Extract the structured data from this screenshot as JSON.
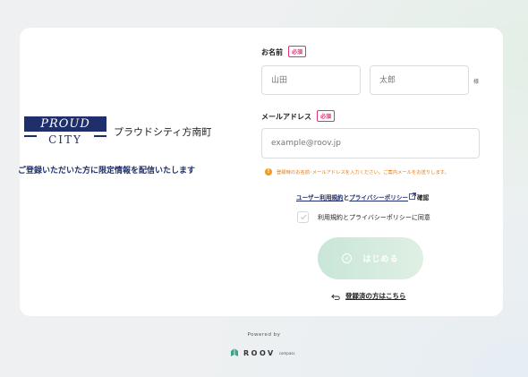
{
  "logo": {
    "mark_top": "PROUD",
    "mark_bottom": "CITY",
    "name": "プラウドシティ方南町"
  },
  "tagline": "ご登録いただいた方に限定情報を配信いたします",
  "form": {
    "name_label": "お名前",
    "required_badge": "必須",
    "last_name_placeholder": "山田",
    "first_name_placeholder": "太郎",
    "honorific": "様",
    "email_label": "メールアドレス",
    "email_placeholder": "example@roov.jp",
    "notice_icon": "!",
    "notice": "登録時のお名前･メールアドレスを入力ください。ご案内メールをお送りします。",
    "terms_link": "ユーザー利用規約",
    "terms_and": "と",
    "privacy_link": "プライバシーポリシー",
    "terms_confirm": "確認",
    "agree_label": "利用規約とプライバシーポリシーに同意",
    "start_button": "はじめる",
    "login_link": "登録済の方はこちら"
  },
  "footer": {
    "powered_by": "Powered by",
    "brand": "ROOV",
    "brand_sub": "compass"
  },
  "colors": {
    "accent_navy": "#1f2f6b",
    "required_pink": "#e0307a",
    "notice_orange": "#e57a12",
    "button_green": "#c8e6d8"
  }
}
